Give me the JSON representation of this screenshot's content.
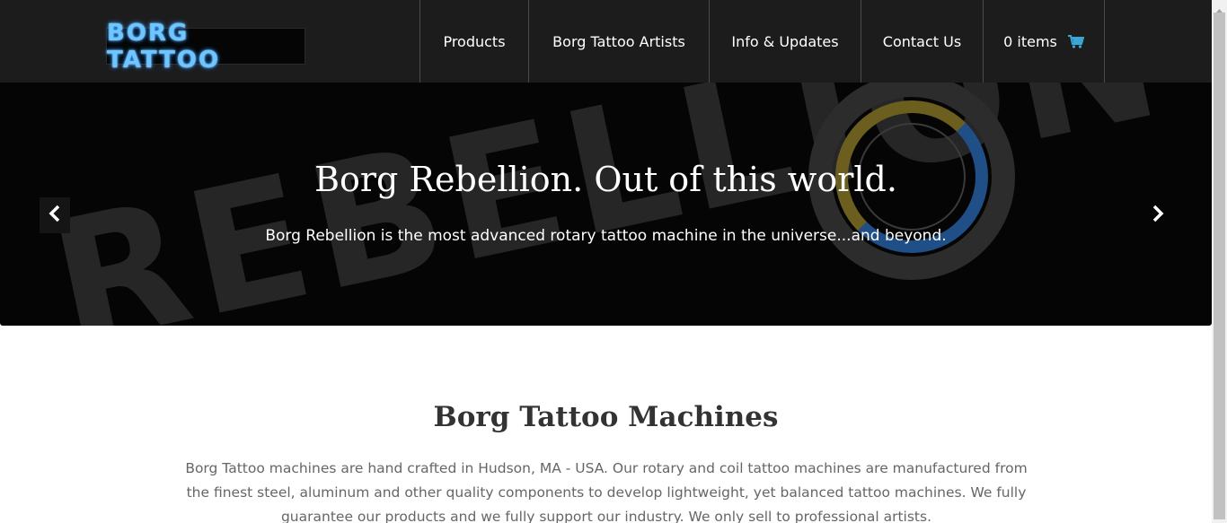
{
  "brand": {
    "logo_text": "BORG TATTOO"
  },
  "nav": {
    "items": [
      {
        "label": "Products"
      },
      {
        "label": "Borg Tattoo Artists"
      },
      {
        "label": "Info & Updates"
      },
      {
        "label": "Contact Us"
      }
    ],
    "cart_label": "0 items",
    "cart_icon": "shopping-cart-icon"
  },
  "hero": {
    "background_text": "REBELLION",
    "title": "Borg Rebellion. Out of this world.",
    "subtitle": "Borg Rebellion is the most advanced rotary tattoo machine in the universe...and beyond.",
    "prev_icon": "chevron-left-icon",
    "next_icon": "chevron-right-icon"
  },
  "section": {
    "title": "Borg Tattoo Machines",
    "text": "Borg Tattoo machines are hand crafted in Hudson, MA - USA. Our rotary and coil tattoo machines are manufactured from the finest steel, aluminum and other quality components to develop lightweight, yet balanced tattoo machines. We fully guarantee our products and we fully support our industry. We only sell to professional artists."
  },
  "colors": {
    "header_bg": "#1c1c1c",
    "accent_cart": "#3aa6d6",
    "logo_glow": "#6fc6ff"
  }
}
